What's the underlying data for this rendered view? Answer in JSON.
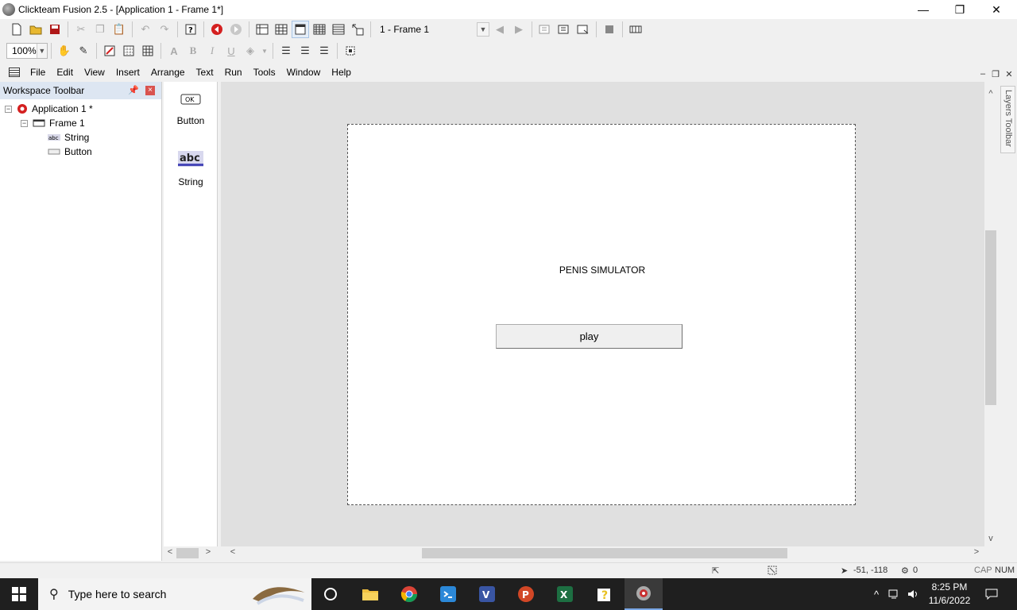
{
  "window": {
    "title": "Clickteam Fusion 2.5 - [Application 1 - Frame 1*]",
    "minimize": "—",
    "restore": "❐",
    "close": "✕"
  },
  "toolbar": {
    "frame_select": "1 - Frame 1",
    "zoom": "100%",
    "bold": "B",
    "italic": "I",
    "underline": "U",
    "prev_frame": "◀",
    "next_frame": "▶"
  },
  "menu": [
    "File",
    "Edit",
    "View",
    "Insert",
    "Arrange",
    "Text",
    "Run",
    "Tools",
    "Window",
    "Help"
  ],
  "workspace": {
    "title": "Workspace Toolbar",
    "tree": {
      "application": "Application 1 *",
      "frame": "Frame 1",
      "objects": [
        "String",
        "Button"
      ]
    }
  },
  "object_toolbar": {
    "items": [
      {
        "label": "Button",
        "icon_text": "OK"
      },
      {
        "label": "String",
        "icon_text": "abc"
      }
    ]
  },
  "frame": {
    "string_text": "PENIS SIMULATOR",
    "button_text": "play"
  },
  "layers_toolbar": "Layers Toolbar",
  "statusbar": {
    "coords": "-51, -118",
    "layer_count": "0",
    "caps": "CAP",
    "num": "NUM"
  },
  "taskbar": {
    "search_placeholder": "Type here to search",
    "time": "8:25 PM",
    "date": "11/6/2022"
  },
  "colors": {
    "workspace_header": "#dde6f2",
    "editor_bg": "#e0e0e0",
    "taskbar": "#1f1f1f"
  }
}
